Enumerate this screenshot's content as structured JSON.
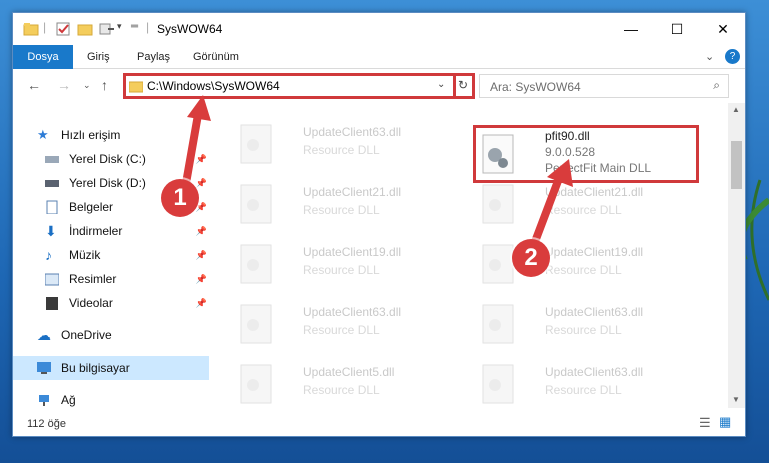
{
  "window": {
    "title": "SysWOW64",
    "minimize_label": "—",
    "maximize_label": "☐",
    "close_label": "✕"
  },
  "ribbon": {
    "tabs": [
      "Dosya",
      "Giriş",
      "Paylaş",
      "Görünüm"
    ]
  },
  "address": {
    "path": "C:\\Windows\\SysWOW64",
    "search_placeholder": "Ara: SysWOW64"
  },
  "nav": {
    "items": [
      {
        "label": "Hızlı erişim",
        "icon": "star-icon"
      },
      {
        "label": "Yerel Disk (C:)",
        "icon": "drive-icon"
      },
      {
        "label": "Yerel Disk (D:)",
        "icon": "drive-icon"
      },
      {
        "label": "Belgeler",
        "icon": "documents-icon"
      },
      {
        "label": "İndirmeler",
        "icon": "download-icon"
      },
      {
        "label": "Müzik",
        "icon": "music-icon"
      },
      {
        "label": "Resimler",
        "icon": "pictures-icon"
      },
      {
        "label": "Videolar",
        "icon": "videos-icon"
      },
      {
        "label": "OneDrive",
        "icon": "cloud-icon"
      },
      {
        "label": "Bu bilgisayar",
        "icon": "computer-icon"
      },
      {
        "label": "Ağ",
        "icon": "network-icon"
      }
    ]
  },
  "files": {
    "highlighted": {
      "name": "pfit90.dll",
      "version": "9.0.0.528",
      "description": "PerfectFit Main DLL"
    },
    "left_column": [
      {
        "name": "UpdateClient63.dll",
        "description": "Resource DLL"
      },
      {
        "name": "UpdateClient21.dll",
        "description": "Resource DLL"
      },
      {
        "name": "UpdateClient19.dll",
        "description": "Resource DLL"
      },
      {
        "name": "UpdateClient63.dll",
        "description": "Resource DLL"
      },
      {
        "name": "UpdateClient5.dll",
        "description": "Resource DLL"
      }
    ],
    "right_column": [
      {
        "name": "UpdateClient21.dll",
        "description": "Resource DLL"
      },
      {
        "name": "UpdateClient19.dll",
        "description": "Resource DLL"
      },
      {
        "name": "UpdateClient63.dll",
        "description": "Resource DLL"
      },
      {
        "name": "UpdateClient63.dll",
        "description": "Resource DLL"
      }
    ]
  },
  "status": {
    "item_count": "112 öğe"
  },
  "annotations": {
    "step1": "1",
    "step2": "2"
  },
  "colors": {
    "accent": "#1979ca",
    "highlight": "#d0393b",
    "selection": "#cce8ff"
  }
}
